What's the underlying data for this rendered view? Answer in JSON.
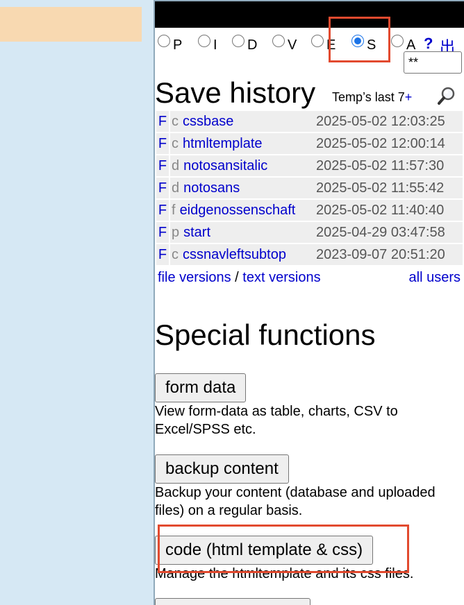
{
  "modes": [
    {
      "label": "P",
      "checked": false
    },
    {
      "label": "I",
      "checked": false
    },
    {
      "label": "D",
      "checked": false
    },
    {
      "label": "V",
      "checked": false
    },
    {
      "label": "E",
      "checked": false
    },
    {
      "label": "S",
      "checked": true
    },
    {
      "label": "A",
      "checked": false
    }
  ],
  "help_label": "?",
  "exit_label": "出",
  "password_value": "**",
  "save_history": {
    "title": "Save history",
    "temps_prefix": "Temp’s last 7",
    "temps_plus": "+",
    "rows": [
      {
        "f": "F",
        "code": "c",
        "name": "cssbase",
        "date": "2025-05-02 12:03:25"
      },
      {
        "f": "F",
        "code": "c",
        "name": "htmltemplate",
        "date": "2025-05-02 12:00:14"
      },
      {
        "f": "F",
        "code": "d",
        "name": "notosansitalic",
        "date": "2025-05-02 11:57:30"
      },
      {
        "f": "F",
        "code": "d",
        "name": "notosans",
        "date": "2025-05-02 11:55:42"
      },
      {
        "f": "F",
        "code": "f",
        "name": "eidgenossenschaft",
        "date": "2025-05-02 11:40:40"
      },
      {
        "f": "F",
        "code": "p",
        "name": "start",
        "date": "2025-04-29 03:47:58"
      },
      {
        "f": "F",
        "code": "c",
        "name": "cssnavleftsubtop",
        "date": "2023-09-07 20:51:20"
      }
    ],
    "file_versions": "file versions",
    "separator": "/",
    "text_versions": "text versions",
    "all_users": "all users"
  },
  "special": {
    "title": "Special functions",
    "items": [
      {
        "label": "form data",
        "desc": "View form-data as table, charts, CSV to Excel/SPSS etc."
      },
      {
        "label": "backup content",
        "desc": "Backup your content (database and uploaded files) on a regular basis."
      },
      {
        "label": "code (html template & css)",
        "desc": "Manage the htmltemplate and its css files."
      }
    ]
  },
  "colors": {
    "left_pane": "#d6e8f4",
    "left_banner": "#f8d9b1",
    "link": "#0000cc",
    "highlight": "#e24a2f",
    "row_bg": "#eeeeee"
  }
}
